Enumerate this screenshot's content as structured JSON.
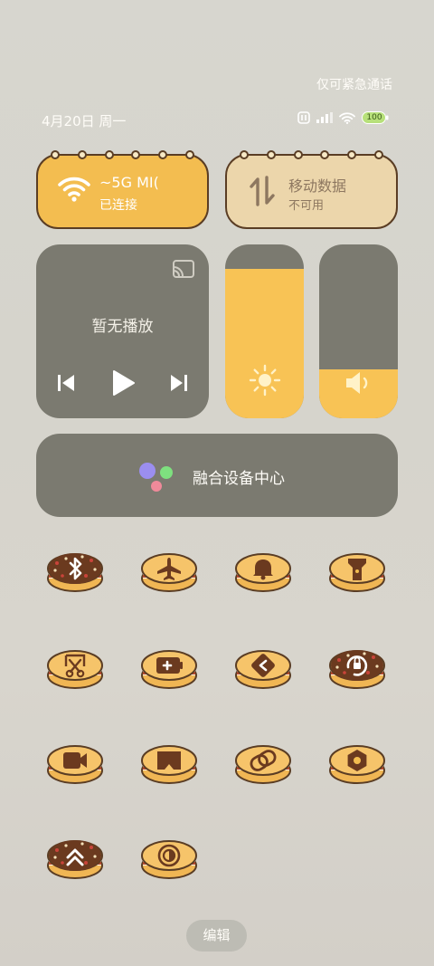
{
  "status": {
    "emergency_only": "仅可紧急通话",
    "date_time": "4月20日 周一",
    "battery_level": "100"
  },
  "wifi_card": {
    "network_name": "~5G   MI(",
    "state": "已连接"
  },
  "mobile_card": {
    "title": "移动数据",
    "state": "不可用"
  },
  "media": {
    "empty_text": "暂无播放"
  },
  "brightness": {
    "level": 0.86
  },
  "volume": {
    "level": 0.28
  },
  "device_center": {
    "label": "融合设备中心"
  },
  "toggles": [
    {
      "icon": "bluetooth-icon",
      "active": true
    },
    {
      "icon": "airplane-icon",
      "active": false
    },
    {
      "icon": "bell-icon",
      "active": false
    },
    {
      "icon": "flashlight-icon",
      "active": false
    },
    {
      "icon": "screenshot-icon",
      "active": false
    },
    {
      "icon": "battery-saver-icon",
      "active": false
    },
    {
      "icon": "location-icon",
      "active": false
    },
    {
      "icon": "rotation-lock-icon",
      "active": true
    },
    {
      "icon": "screen-record-icon",
      "active": false
    },
    {
      "icon": "vr-icon",
      "active": false
    },
    {
      "icon": "link-icon",
      "active": false
    },
    {
      "icon": "hexagon-icon",
      "active": false
    },
    {
      "icon": "chevron-up-icon",
      "active": true
    },
    {
      "icon": "contrast-icon",
      "active": false
    }
  ],
  "edit_button": {
    "label": "编辑"
  },
  "colors": {
    "card_yellow": "#f3bd50",
    "card_beige": "#ecd6ab",
    "panel_gray": "#7b7a70",
    "slider_fill": "#f8c355",
    "cookie_border": "#5a3d24",
    "chocolate": "#6b3a1f"
  }
}
